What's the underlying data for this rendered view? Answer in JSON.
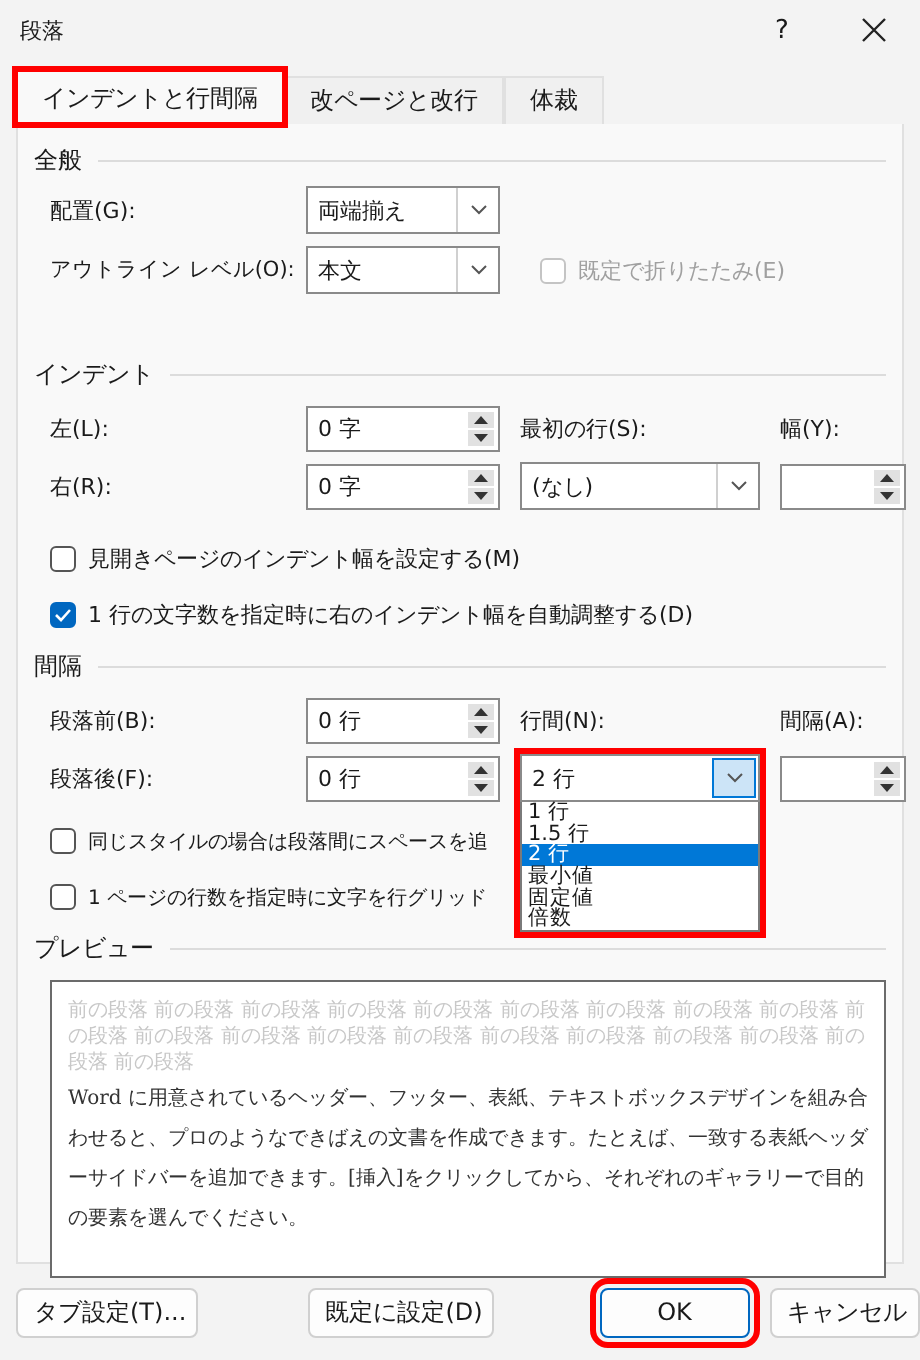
{
  "window": {
    "title": "段落",
    "help": "?"
  },
  "tabs": [
    {
      "label": "インデントと行間隔",
      "selected": true,
      "highlighted": true
    },
    {
      "label": "改ページと改行",
      "selected": false,
      "highlighted": false
    },
    {
      "label": "体裁",
      "selected": false,
      "highlighted": false
    }
  ],
  "general": {
    "heading": "全般",
    "alignment": {
      "label": "配置(G):",
      "value": "両端揃え"
    },
    "outline_level": {
      "label": "アウトライン レベル(O):",
      "value": "本文"
    },
    "collapse": {
      "label": "既定で折りたたみ(E)",
      "checked": false,
      "disabled": true
    }
  },
  "indent": {
    "heading": "インデント",
    "left": {
      "label": "左(L):",
      "value": "0 字"
    },
    "right": {
      "label": "右(R):",
      "value": "0 字"
    },
    "first_line": {
      "label": "最初の行(S):",
      "value": "(なし)"
    },
    "by": {
      "label": "幅(Y):"
    },
    "mirror": {
      "label": "見開きページのインデント幅を設定する(M)",
      "checked": false
    },
    "auto_adjust": {
      "label": "1 行の文字数を指定時に右のインデント幅を自動調整する(D)",
      "checked": true
    }
  },
  "spacing": {
    "heading": "間隔",
    "before": {
      "label": "段落前(B):",
      "value": "0 行"
    },
    "after": {
      "label": "段落後(F):",
      "value": "0 行"
    },
    "line_spacing": {
      "label": "行間(N):",
      "value": "2 行",
      "expanded": true,
      "highlighted": true,
      "options": [
        {
          "label": "1 行",
          "selected": false
        },
        {
          "label": "1.5 行",
          "selected": false
        },
        {
          "label": "2 行",
          "selected": true
        },
        {
          "label": "最小値",
          "selected": false
        },
        {
          "label": "固定値",
          "selected": false
        },
        {
          "label": "倍数",
          "selected": false
        }
      ]
    },
    "at": {
      "label": "間隔(A):"
    },
    "no_space": {
      "label": "同じスタイルの場合は段落間にスペースを追",
      "checked": false
    },
    "snap_grid": {
      "label": "1 ページの行数を指定時に文字を行グリッド",
      "checked": false
    }
  },
  "preview": {
    "heading": "プレビュー",
    "previous_lines": [
      "前の段落 前の段落 前の段落 前の段落 前の段落 前の段落 前の段落 前の段落 前の段落 前",
      "の段落 前の段落 前の段落 前の段落 前の段落 前の段落 前の段落 前の段落 前の段落 前の",
      "段落 前の段落"
    ],
    "current_paragraph": "Word に用意されているヘッダー、フッター、表紙、テキストボックスデザインを組み合わせると、プロのようなできばえの文書を作成できます。たとえば、一致する表紙ヘッダーサイドバーを追加できます。[挿入]をクリックしてから、それぞれのギャラリーで目的の要素を選んでください。"
  },
  "buttons": [
    {
      "label": "タブ設定(T)...",
      "highlighted": false
    },
    {
      "label": "既定に設定(D)",
      "highlighted": false
    },
    {
      "label": "OK",
      "highlighted": true
    },
    {
      "label": "キャンセル",
      "highlighted": false
    }
  ]
}
